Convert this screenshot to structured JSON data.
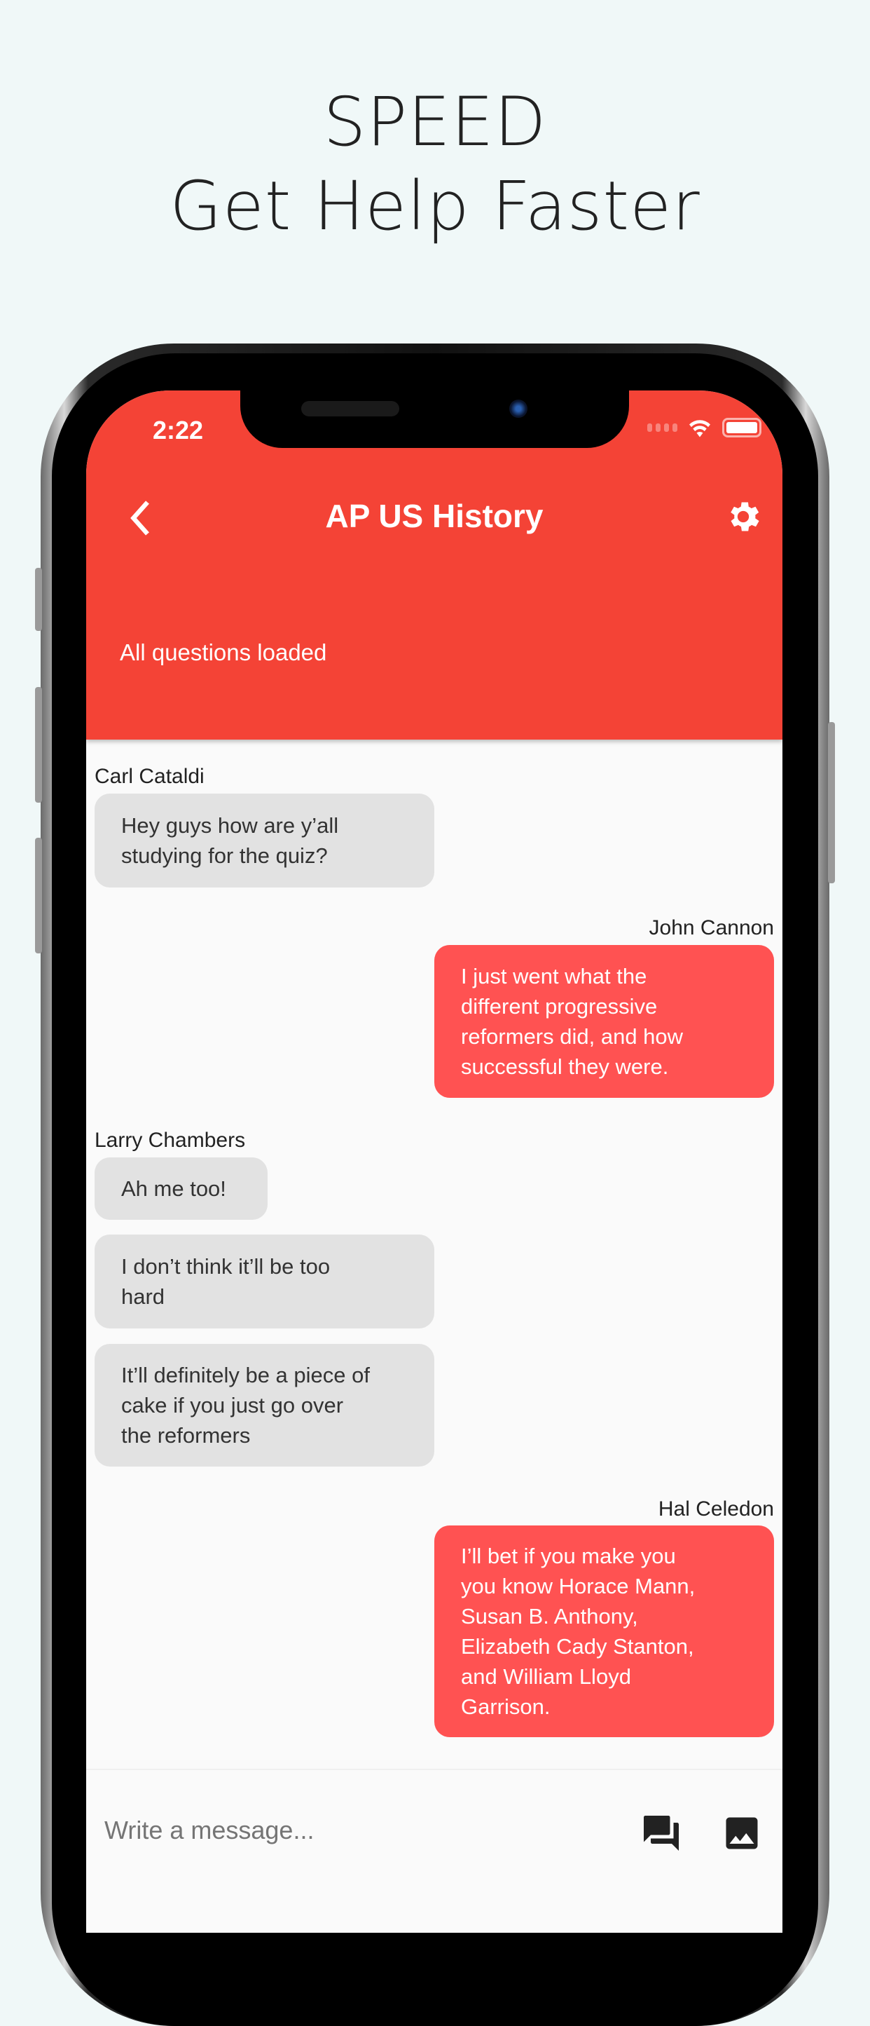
{
  "promo": {
    "line1": "SPEED",
    "line2": "Get Help Faster"
  },
  "status_bar": {
    "time": "2:22"
  },
  "header": {
    "title": "AP US History",
    "subtitle": "All questions loaded",
    "accent": "#F44336"
  },
  "messages": [
    {
      "sender": "Carl Cataldi",
      "side": "in",
      "bubbles": [
        [
          "Hey guys how are y’all",
          "studying for the quiz?"
        ]
      ]
    },
    {
      "sender": "John Cannon",
      "side": "out",
      "bubbles": [
        [
          "I just went what the",
          "different progressive",
          "reformers did, and how",
          "successful they were."
        ]
      ]
    },
    {
      "sender": "Larry Chambers",
      "side": "in",
      "bubbles": [
        [
          "Ah me too!"
        ],
        [
          "I don’t think it’ll be too",
          "hard"
        ],
        [
          "It’ll definitely be a piece of",
          "cake if you just go over",
          "the reformers"
        ]
      ]
    },
    {
      "sender": "Hal Celedon",
      "side": "out",
      "bubbles": [
        [
          "I’ll bet if you make you",
          "you know Horace Mann,",
          "Susan B. Anthony,",
          "Elizabeth Cady Stanton,",
          "and William Lloyd",
          "Garrison."
        ]
      ]
    }
  ],
  "composer": {
    "placeholder": "Write a message..."
  }
}
